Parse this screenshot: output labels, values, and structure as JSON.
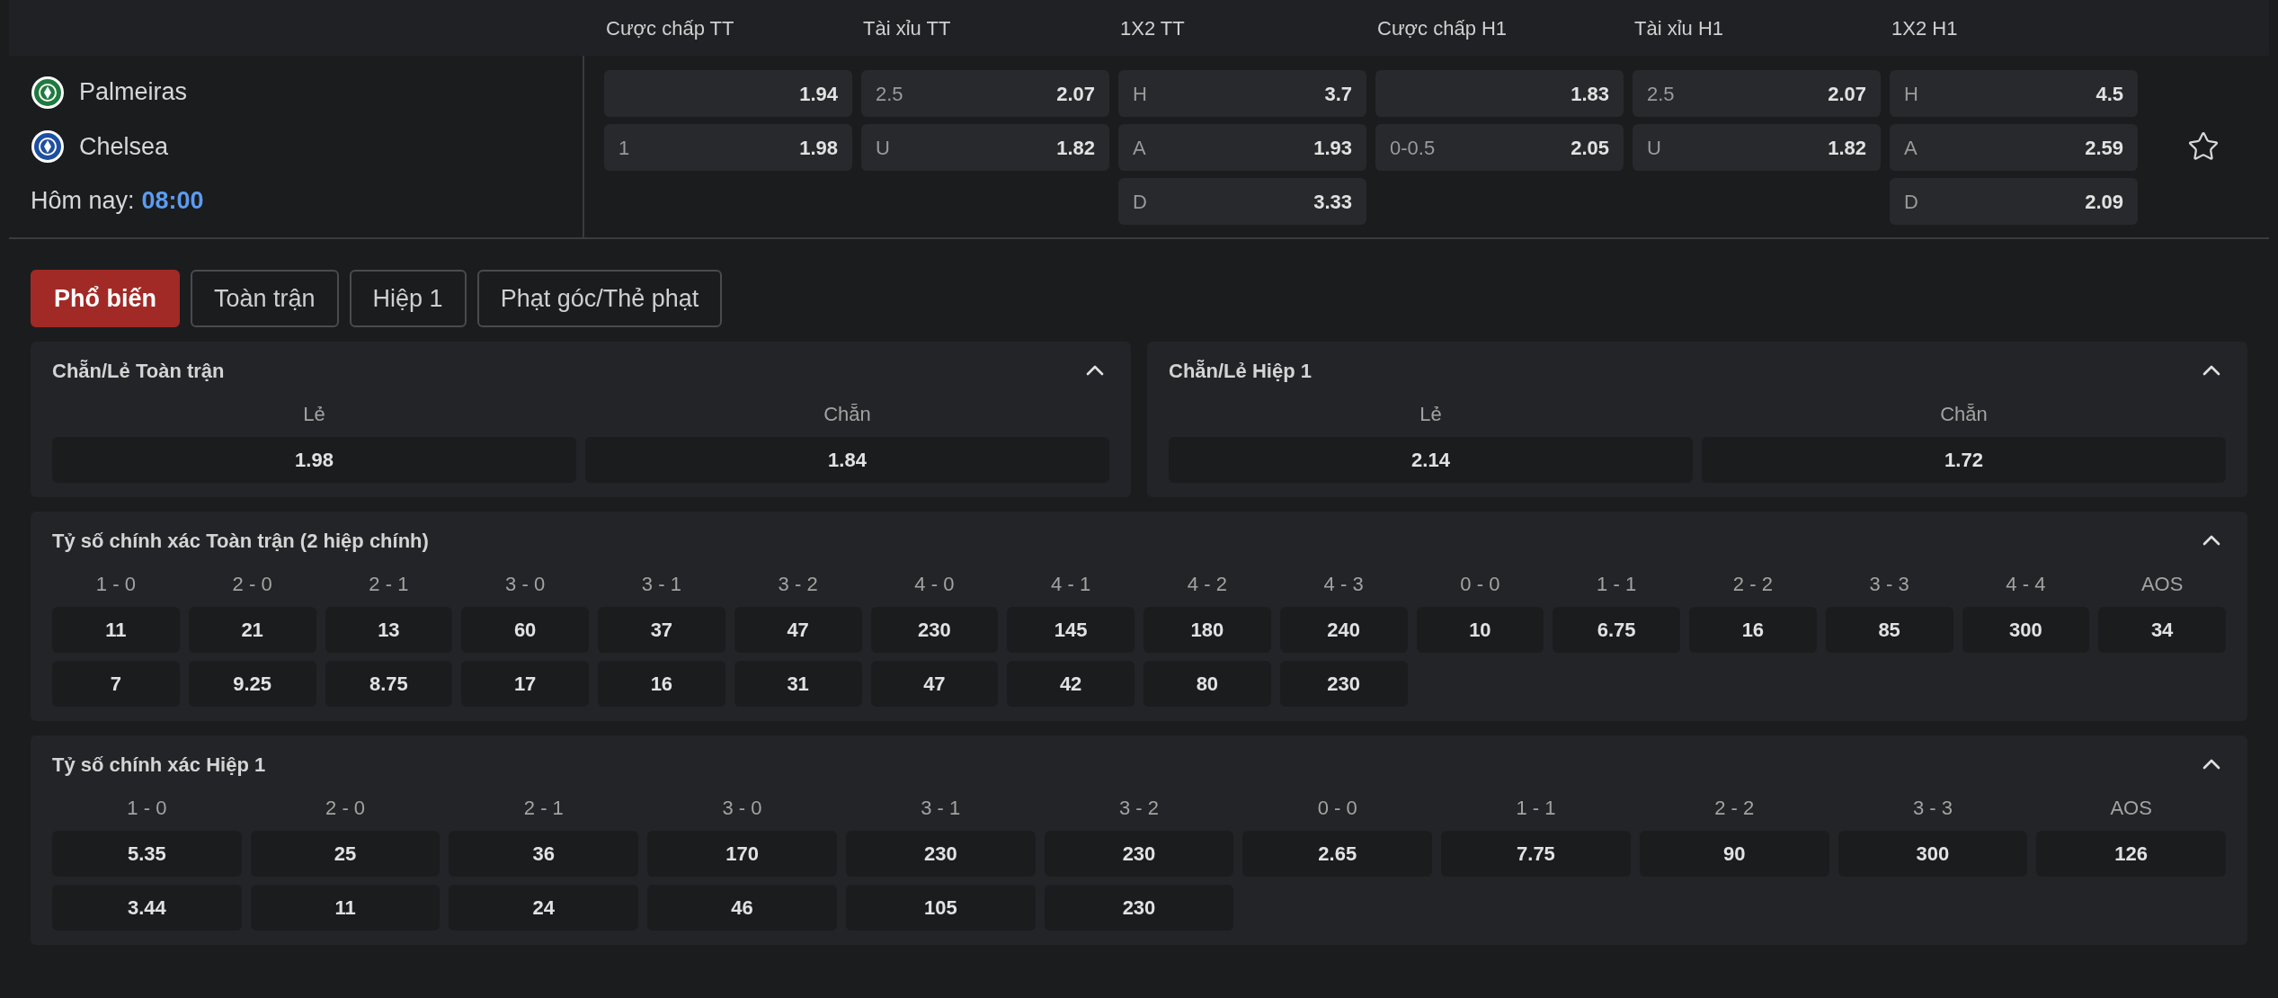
{
  "columns": [
    "Cược chấp TT",
    "Tài xỉu TT",
    "1X2 TT",
    "Cược chấp H1",
    "Tài xỉu H1",
    "1X2 H1"
  ],
  "match": {
    "home": {
      "name": "Palmeiras",
      "color": "#1f7a3e"
    },
    "away": {
      "name": "Chelsea",
      "color": "#1e4fa0"
    },
    "date_label": "Hôm nay:",
    "time": "08:00",
    "favorite": false,
    "markets": [
      [
        {
          "odds": "1.94"
        },
        {
          "label": "1",
          "odds": "1.98"
        }
      ],
      [
        {
          "label": "2.5",
          "odds": "2.07"
        },
        {
          "label": "U",
          "odds": "1.82"
        }
      ],
      [
        {
          "label": "H",
          "odds": "3.7"
        },
        {
          "label": "A",
          "odds": "1.93"
        },
        {
          "label": "D",
          "odds": "3.33"
        }
      ],
      [
        {
          "odds": "1.83"
        },
        {
          "label": "0-0.5",
          "odds": "2.05"
        }
      ],
      [
        {
          "label": "2.5",
          "odds": "2.07"
        },
        {
          "label": "U",
          "odds": "1.82"
        }
      ],
      [
        {
          "label": "H",
          "odds": "4.5"
        },
        {
          "label": "A",
          "odds": "2.59"
        },
        {
          "label": "D",
          "odds": "2.09"
        }
      ]
    ]
  },
  "tabs": [
    {
      "label": "Phổ biến",
      "selected": true
    },
    {
      "label": "Toàn trận",
      "selected": false
    },
    {
      "label": "Hiệp 1",
      "selected": false
    },
    {
      "label": "Phạt góc/Thẻ phạt",
      "selected": false
    }
  ],
  "panel_rows": [
    [
      {
        "title": "Chẵn/Lẻ Toàn trận",
        "expanded": true,
        "outcomes": [
          {
            "label": "Lẻ",
            "odds": [
              "1.98"
            ]
          },
          {
            "label": "Chẵn",
            "odds": [
              "1.84"
            ]
          }
        ]
      },
      {
        "title": "Chẵn/Lẻ Hiệp 1",
        "expanded": true,
        "outcomes": [
          {
            "label": "Lẻ",
            "odds": [
              "2.14"
            ]
          },
          {
            "label": "Chẵn",
            "odds": [
              "1.72"
            ]
          }
        ]
      }
    ],
    [
      {
        "title": "Tỷ số chính xác Toàn trận (2 hiệp chính)",
        "expanded": true,
        "outcomes": [
          {
            "label": "1 - 0",
            "odds": [
              "11",
              "7"
            ]
          },
          {
            "label": "2 - 0",
            "odds": [
              "21",
              "9.25"
            ]
          },
          {
            "label": "2 - 1",
            "odds": [
              "13",
              "8.75"
            ]
          },
          {
            "label": "3 - 0",
            "odds": [
              "60",
              "17"
            ]
          },
          {
            "label": "3 - 1",
            "odds": [
              "37",
              "16"
            ]
          },
          {
            "label": "3 - 2",
            "odds": [
              "47",
              "31"
            ]
          },
          {
            "label": "4 - 0",
            "odds": [
              "230",
              "47"
            ]
          },
          {
            "label": "4 - 1",
            "odds": [
              "145",
              "42"
            ]
          },
          {
            "label": "4 - 2",
            "odds": [
              "180",
              "80"
            ]
          },
          {
            "label": "4 - 3",
            "odds": [
              "240",
              "230"
            ]
          },
          {
            "label": "0 - 0",
            "odds": [
              "10"
            ]
          },
          {
            "label": "1 - 1",
            "odds": [
              "6.75"
            ]
          },
          {
            "label": "2 - 2",
            "odds": [
              "16"
            ]
          },
          {
            "label": "3 - 3",
            "odds": [
              "85"
            ]
          },
          {
            "label": "4 - 4",
            "odds": [
              "300"
            ]
          },
          {
            "label": "AOS",
            "odds": [
              "34"
            ]
          }
        ]
      }
    ],
    [
      {
        "title": "Tỷ số chính xác Hiệp 1",
        "expanded": true,
        "outcomes": [
          {
            "label": "1 - 0",
            "odds": [
              "5.35",
              "3.44"
            ]
          },
          {
            "label": "2 - 0",
            "odds": [
              "25",
              "11"
            ]
          },
          {
            "label": "2 - 1",
            "odds": [
              "36",
              "24"
            ]
          },
          {
            "label": "3 - 0",
            "odds": [
              "170",
              "46"
            ]
          },
          {
            "label": "3 - 1",
            "odds": [
              "230",
              "105"
            ]
          },
          {
            "label": "3 - 2",
            "odds": [
              "230",
              "230"
            ]
          },
          {
            "label": "0 - 0",
            "odds": [
              "2.65"
            ]
          },
          {
            "label": "1 - 1",
            "odds": [
              "7.75"
            ]
          },
          {
            "label": "2 - 2",
            "odds": [
              "90"
            ]
          },
          {
            "label": "3 - 3",
            "odds": [
              "300"
            ]
          },
          {
            "label": "AOS",
            "odds": [
              "126"
            ]
          }
        ]
      }
    ]
  ]
}
